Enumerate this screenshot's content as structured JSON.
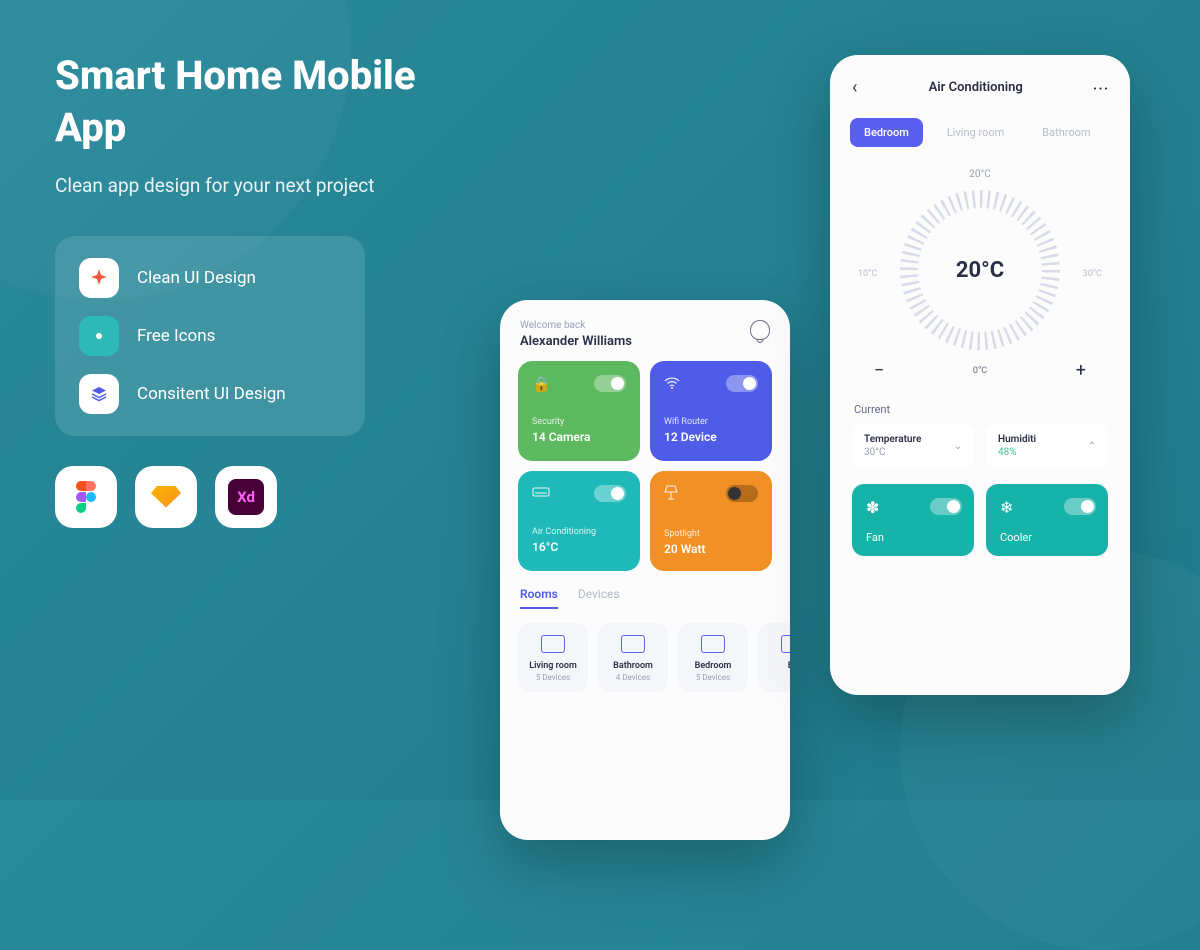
{
  "promo": {
    "title": "Smart Home Mobile App",
    "subtitle": "Clean app design for your next project",
    "features": [
      "Clean UI Design",
      "Free Icons",
      "Consitent UI Design"
    ]
  },
  "phone1": {
    "welcome": "Welcome back",
    "username": "Alexander Williams",
    "tiles": [
      {
        "label": "Security",
        "value": "14 Camera"
      },
      {
        "label": "Wifi Router",
        "value": "12 Device"
      },
      {
        "label": "Air Conditioning",
        "value": "16°C"
      },
      {
        "label": "Spotlight",
        "value": "20 Watt"
      }
    ],
    "tabs": [
      "Rooms",
      "Devices"
    ],
    "rooms": [
      {
        "name": "Living room",
        "count": "5 Devices"
      },
      {
        "name": "Bathroom",
        "count": "4 Devices"
      },
      {
        "name": "Bedroom",
        "count": "5 Devices"
      },
      {
        "name": "Be",
        "count": ""
      }
    ]
  },
  "phone2": {
    "title": "Air Conditioning",
    "tabs": [
      "Bedroom",
      "Living room",
      "Bathroom"
    ],
    "topTemp": "20°C",
    "leftTemp": "10°C",
    "rightTemp": "30°C",
    "centerTemp": "20°C",
    "bottomTemp": "0°C",
    "currentLabel": "Current",
    "stats": [
      {
        "name": "Temperature",
        "value": "30°C"
      },
      {
        "name": "Humiditi",
        "value": "48%"
      }
    ],
    "controls": [
      "Fan",
      "Cooler"
    ]
  }
}
